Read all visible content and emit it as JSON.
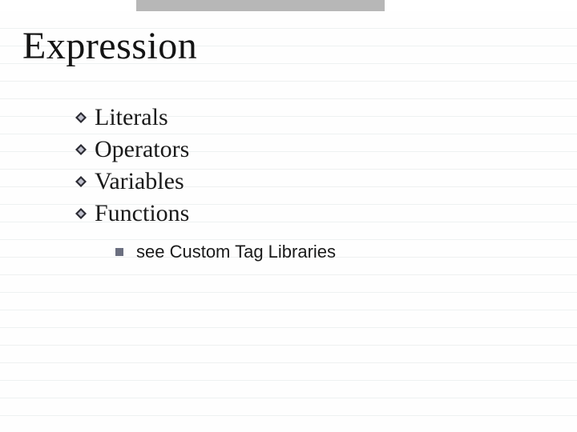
{
  "slide": {
    "title": "Expression",
    "bullets": [
      {
        "text": "Literals"
      },
      {
        "text": "Operators"
      },
      {
        "text": "Variables"
      },
      {
        "text": "Functions"
      }
    ],
    "sub_bullet": {
      "text": "see Custom Tag Libraries"
    },
    "colors": {
      "bullet_dark": "#2b2b33",
      "bullet_light": "#bfc0cc",
      "sub_square": "#6b6f80",
      "topbar": "#b7b7b7"
    }
  }
}
